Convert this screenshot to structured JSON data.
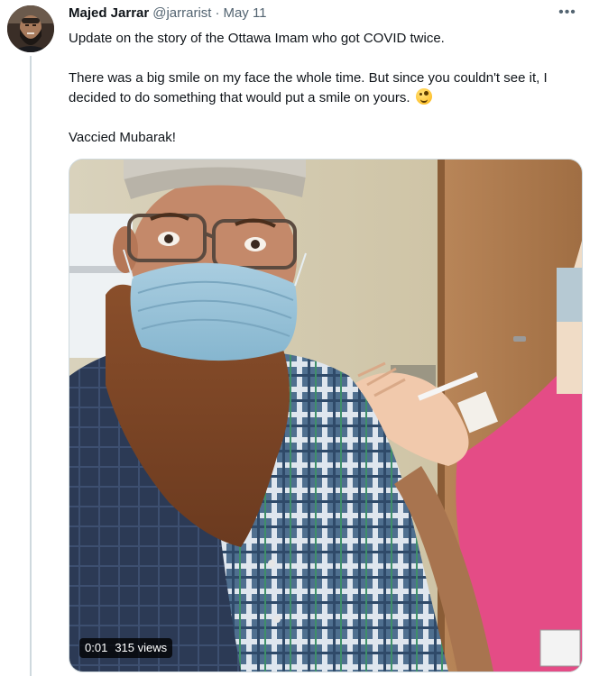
{
  "tweet": {
    "author_name": "Majed Jarrar",
    "author_handle": "@jarrarist",
    "separator": "·",
    "date": "May 11",
    "more_icon": "more-horizontal-icon",
    "more_label": "•••",
    "paragraphs": [
      "Update on the story of the Ottawa Imam who got COVID twice.",
      "There was a big smile on my face the whole time. But since you couldn't see it, I decided to do something that would put a smile on yours.",
      "Vaccied Mubarak!"
    ],
    "emoji": "zany-face-icon"
  },
  "video": {
    "timestamp": "0:01",
    "views": "315 views"
  },
  "colors": {
    "text_primary": "#0f1419",
    "text_secondary": "#536471",
    "border": "#cfd9de"
  }
}
